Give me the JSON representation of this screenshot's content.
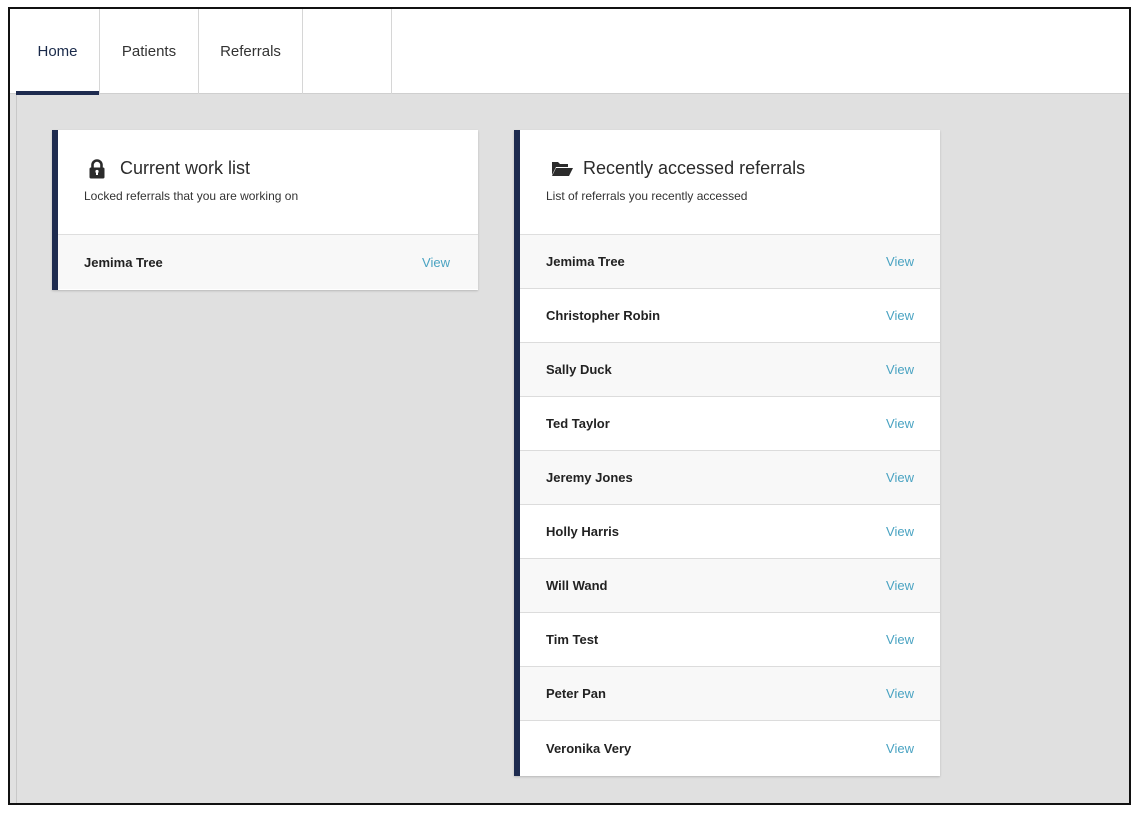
{
  "tabs": [
    {
      "label": "Home",
      "active": true
    },
    {
      "label": "Patients",
      "active": false
    },
    {
      "label": "Referrals",
      "active": false
    },
    {
      "label": "",
      "active": false
    }
  ],
  "current_work_list": {
    "icon": "lock-icon",
    "title": "Current work list",
    "subtitle": "Locked referrals that you are working on",
    "rows": [
      {
        "name": "Jemima Tree",
        "action": "View"
      }
    ]
  },
  "recent_referrals": {
    "icon": "folder-open-icon",
    "title": "Recently accessed referrals",
    "subtitle": "List of referrals you recently accessed",
    "rows": [
      {
        "name": "Jemima Tree",
        "action": "View"
      },
      {
        "name": "Christopher Robin",
        "action": "View"
      },
      {
        "name": "Sally Duck",
        "action": "View"
      },
      {
        "name": "Ted Taylor",
        "action": "View"
      },
      {
        "name": "Jeremy Jones",
        "action": "View"
      },
      {
        "name": "Holly Harris",
        "action": "View"
      },
      {
        "name": "Will Wand",
        "action": "View"
      },
      {
        "name": "Tim Test",
        "action": "View"
      },
      {
        "name": "Peter Pan",
        "action": "View"
      },
      {
        "name": "Veronika Very",
        "action": "View"
      }
    ]
  },
  "colors": {
    "accent": "#1e2b4f",
    "link": "#4aa3c2",
    "background": "#e0e0e0"
  }
}
